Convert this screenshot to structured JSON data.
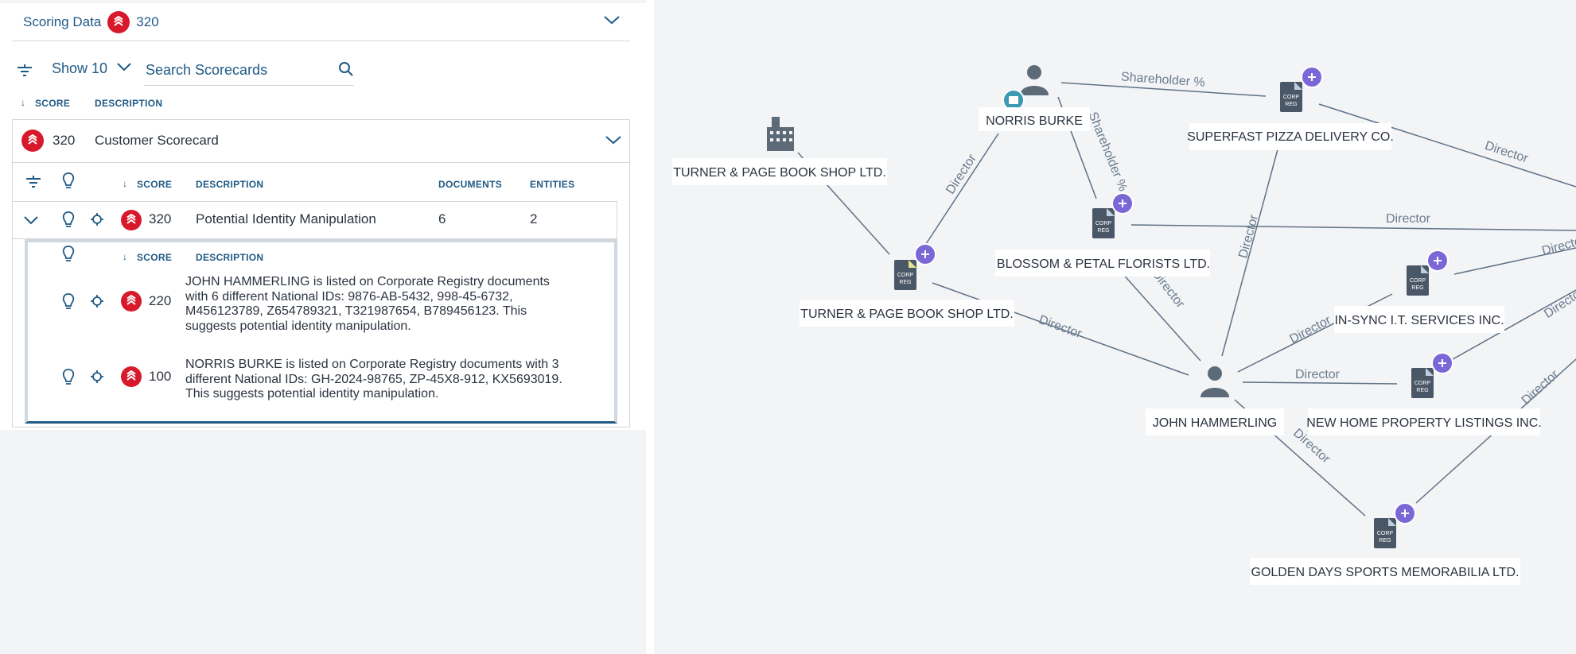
{
  "scoring": {
    "title": "Scoring Data",
    "score": "320"
  },
  "toolbar": {
    "show_label": "Show 10",
    "search_placeholder": "Search Scorecards"
  },
  "columns": {
    "score": "SCORE",
    "description": "DESCRIPTION",
    "documents": "DOCUMENTS",
    "entities": "ENTITIES"
  },
  "scorecard": {
    "score": "320",
    "name": "Customer Scorecard"
  },
  "rule": {
    "score": "320",
    "description": "Potential Identity Manipulation",
    "documents": "6",
    "entities": "2"
  },
  "details": [
    {
      "score": "220",
      "lines": [
        "JOHN HAMMERLING is listed on Corporate Registry documents",
        "with 6 different National IDs: 9876-AB-5432, 998-45-6732,",
        "M456123789, Z654789321, T321987654, B789456123. This",
        "suggests potential identity manipulation."
      ]
    },
    {
      "score": "100",
      "lines": [
        "NORRIS BURKE is listed on Corporate Registry documents with 3",
        "different National IDs: GH-2024-98765, ZP-45X8-912, KX5693019.",
        "This suggests potential identity manipulation."
      ]
    }
  ],
  "graph": {
    "doc_glyph": [
      "CORP",
      "REG"
    ],
    "nodes": [
      {
        "id": "norris",
        "type": "person",
        "label": "NORRIS BURKE",
        "badge": "note"
      },
      {
        "id": "superfast",
        "type": "doc",
        "label": "SUPERFAST PIZZA DELIVERY CO."
      },
      {
        "id": "turner_bldg",
        "type": "building",
        "label": "TURNER & PAGE BOOK SHOP LTD."
      },
      {
        "id": "blossom",
        "type": "doc",
        "label": "BLOSSOM & PETAL FLORISTS LTD."
      },
      {
        "id": "turner_doc",
        "type": "doc",
        "label": "TURNER & PAGE BOOK SHOP LTD."
      },
      {
        "id": "insync",
        "type": "doc",
        "label": "IN-SYNC I.T. SERVICES INC."
      },
      {
        "id": "john",
        "type": "person",
        "label": "JOHN HAMMERLING"
      },
      {
        "id": "newhome",
        "type": "doc",
        "label": "NEW HOME PROPERTY LISTINGS INC."
      },
      {
        "id": "golden",
        "type": "doc",
        "label": "GOLDEN DAYS SPORTS MEMORABILIA LTD."
      }
    ],
    "edge_labels": {
      "norris_superfast": "Shareholder %",
      "norris_blossom": "Shareholder %",
      "norris_turner": "Director",
      "superfast_right": "Director",
      "blossom_right": "Director",
      "superfast_john": "Director",
      "blossom_john": "Director",
      "turner_john": "Director",
      "john_insync": "Director",
      "insync_right": "Director",
      "john_newhome": "Director",
      "newhome_right": "Director",
      "john_golden": "Director",
      "golden_right": "Director"
    }
  },
  "dock": [
    {
      "name": "bubbles-icon"
    },
    {
      "name": "flask-icon"
    },
    {
      "name": "sliders-icon"
    },
    {
      "name": "clock-icon"
    }
  ],
  "colors": {
    "accent": "#1f5a85",
    "severity": "#d7192b",
    "node_plus": "#7b68d6",
    "doc": "#4a5766",
    "dock": "#1f4e6e"
  }
}
